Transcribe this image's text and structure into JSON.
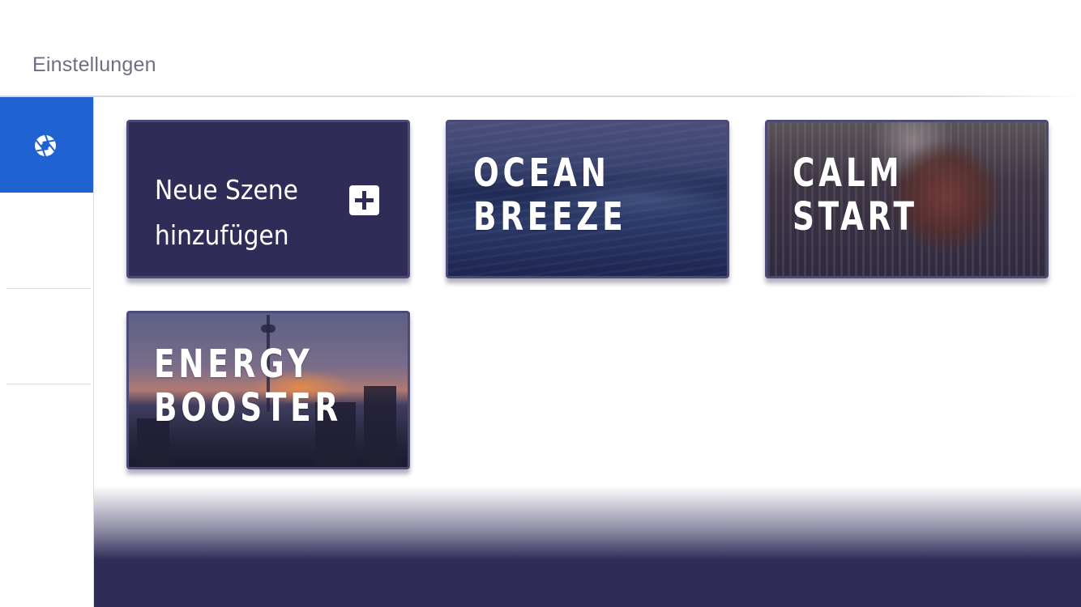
{
  "header": {
    "title": "Einstellungen"
  },
  "sidebar": {
    "items": [
      {
        "icon": "aperture-icon",
        "active": true
      },
      {
        "icon": "",
        "active": false
      },
      {
        "icon": "",
        "active": false
      }
    ],
    "active_color": "#1f62d2"
  },
  "scenes": {
    "add": {
      "line1": "Neue Szene",
      "line2": "hinzufügen",
      "icon": "plus-icon"
    },
    "items": [
      {
        "line1": "OCEAN",
        "line2": "BREEZE"
      },
      {
        "line1": "CALM",
        "line2": "START"
      },
      {
        "line1": "ENERGY",
        "line2": "BOOSTER"
      }
    ]
  },
  "colors": {
    "primary_dark": "#2f2c58",
    "card_border": "#4b4a78",
    "text_muted": "#6f6e86"
  }
}
